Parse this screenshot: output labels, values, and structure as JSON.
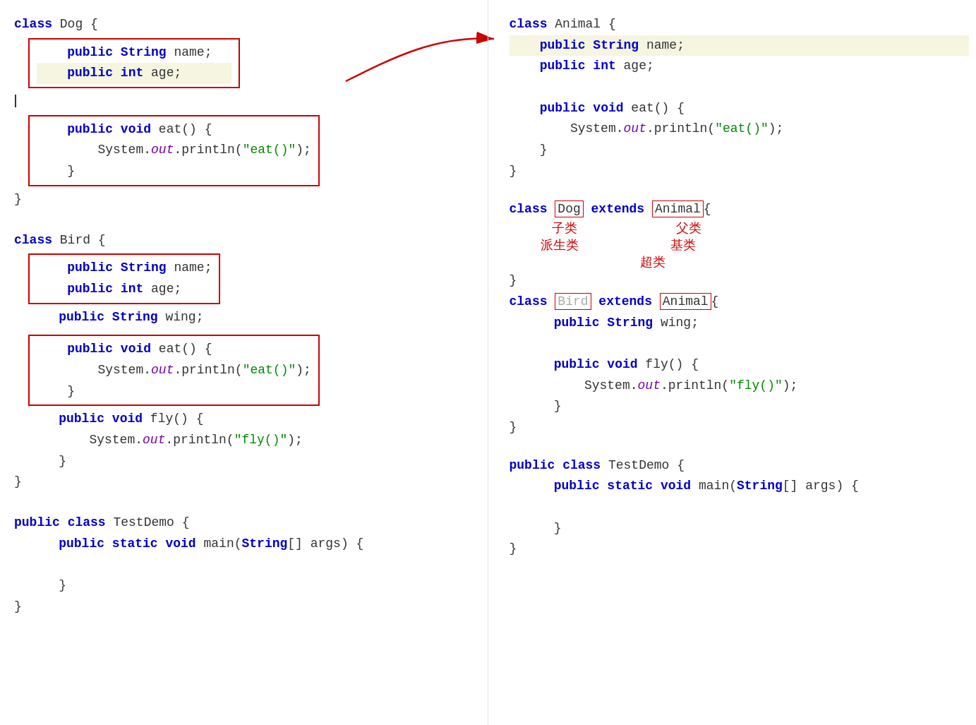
{
  "left": {
    "dog_class": {
      "header": "class Dog {",
      "fields_box": [
        "    public String name;",
        "    public int age;"
      ],
      "cursor_line": true,
      "methods_box": [
        "    public void eat() {",
        "        System.out.println(\"eat()\");",
        "    }"
      ],
      "footer": "}"
    },
    "bird_class": {
      "header": "class Bird {",
      "fields_box": [
        "    public String name;",
        "    public int age;"
      ],
      "wing_line": "    public String wing;",
      "eat_box": [
        "    public void eat() {",
        "        System.out.println(\"eat()\");",
        "    }"
      ],
      "fly_method": [
        "    public void fly() {",
        "        System.out.println(\"fly()\");",
        "    }"
      ],
      "footer": "}"
    },
    "test_class": {
      "header": "public class TestDemo {",
      "method": "    public static void main(String[] args) {",
      "body": "",
      "close1": "    }",
      "close2": "}"
    }
  },
  "right": {
    "animal_class": {
      "header": "class Animal {",
      "name_line_highlighted": "    public String name;",
      "age_line": "    public int age;",
      "eat_method": [
        "    public void eat() {",
        "        System.out.println(\"eat()\");",
        "    }"
      ],
      "footer": "}"
    },
    "dog_extends": {
      "line": "class Dog extends Animal{",
      "dog_label": "子类",
      "animal_label": "父类",
      "subclass_label": "派生类",
      "base_label": "基类",
      "super_label": "超类",
      "body": "}",
      "bird_line": "class Bird extends Animal{"
    },
    "bird_extends": {
      "wing": "    public String wing;",
      "fly_method": [
        "    public void fly() {",
        "        System.out.println(\"fly()\");",
        "    }"
      ],
      "footer": "}"
    },
    "test_class": {
      "header": "public class TestDemo {",
      "method": "    public static void main(String[] args) {",
      "close1": "    }",
      "close2": "}"
    }
  }
}
